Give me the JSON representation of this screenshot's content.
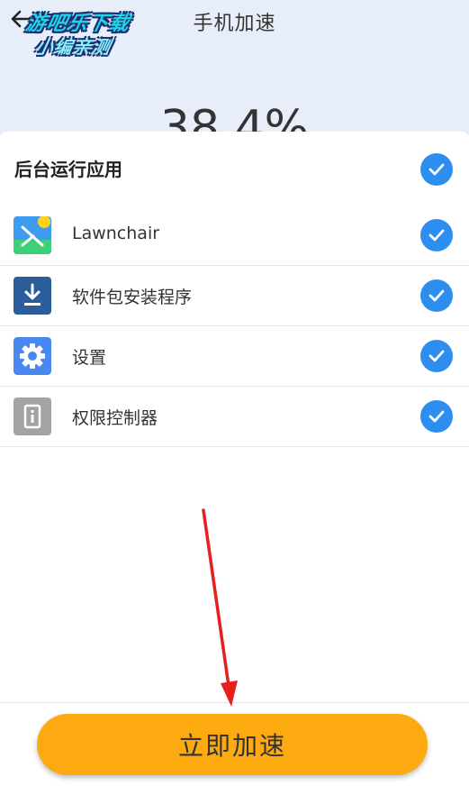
{
  "header": {
    "title": "手机加速",
    "back_icon": "back-arrow-icon",
    "percent_value": "38.4%"
  },
  "watermark": {
    "line1": "游吧乐下载",
    "line2": "小编亲测"
  },
  "section": {
    "title": "后台运行应用",
    "select_all_checked": true
  },
  "apps": [
    {
      "label": "Lawnchair",
      "icon": "lawnchair-icon",
      "checked": true
    },
    {
      "label": "软件包安装程序",
      "icon": "package-installer-icon",
      "checked": true
    },
    {
      "label": "设置",
      "icon": "settings-gear-icon",
      "checked": true
    },
    {
      "label": "权限控制器",
      "icon": "permission-controller-icon",
      "checked": true
    }
  ],
  "action": {
    "boost_label": "立即加速"
  },
  "colors": {
    "accent_blue": "#2d8ef0",
    "button_orange": "#fcaa10",
    "top_background": "#e8eef9",
    "annotation_red": "#e8201c"
  }
}
